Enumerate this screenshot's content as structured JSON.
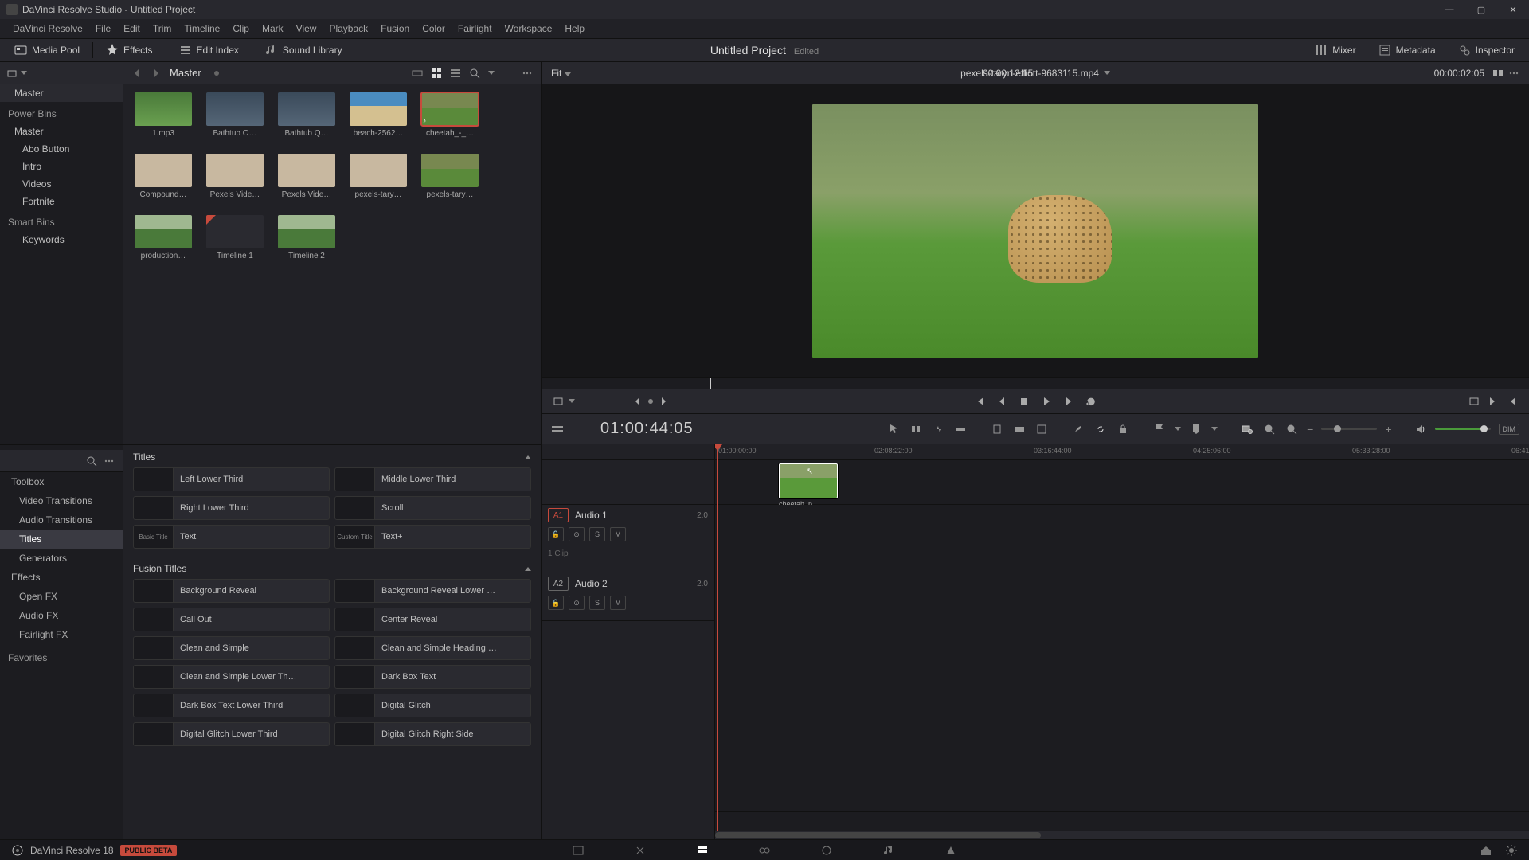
{
  "window": {
    "title": "DaVinci Resolve Studio - Untitled Project"
  },
  "menu": [
    "DaVinci Resolve",
    "File",
    "Edit",
    "Trim",
    "Timeline",
    "Clip",
    "Mark",
    "View",
    "Playback",
    "Fusion",
    "Color",
    "Fairlight",
    "Workspace",
    "Help"
  ],
  "toolbar": {
    "mediapool": "Media Pool",
    "effects": "Effects",
    "editindex": "Edit Index",
    "soundlib": "Sound Library",
    "project": "Untitled Project",
    "edited": "Edited",
    "mixer": "Mixer",
    "metadata": "Metadata",
    "inspector": "Inspector"
  },
  "bins": {
    "root": "Master",
    "power_title": "Power Bins",
    "power_root": "Master",
    "power_items": [
      "Abo Button",
      "Intro",
      "Videos",
      "Fortnite"
    ],
    "smart_title": "Smart Bins",
    "smart_items": [
      "Keywords"
    ]
  },
  "clipshead": {
    "title": "Master"
  },
  "clips": [
    {
      "label": "1.mp3",
      "cls": "audio"
    },
    {
      "label": "Bathtub O…",
      "cls": "video"
    },
    {
      "label": "Bathtub Q…",
      "cls": "video"
    },
    {
      "label": "beach-2562…",
      "cls": "beach"
    },
    {
      "label": "cheetah_-_…",
      "cls": "cheetah",
      "selected": true,
      "badge": "♪"
    },
    {
      "label": "Compound…",
      "cls": "indoor"
    },
    {
      "label": "Pexels Vide…",
      "cls": "indoor"
    },
    {
      "label": "Pexels Vide…",
      "cls": "indoor"
    },
    {
      "label": "pexels-tary…",
      "cls": "indoor"
    },
    {
      "label": "pexels-tary…",
      "cls": "cheetah"
    },
    {
      "label": "production…",
      "cls": "grass"
    },
    {
      "label": "Timeline 1",
      "cls": "tl"
    },
    {
      "label": "Timeline 2",
      "cls": "grass"
    }
  ],
  "fx": {
    "cats_root": "Toolbox",
    "cats": [
      "Video Transitions",
      "Audio Transitions",
      "Titles",
      "Generators"
    ],
    "cats2_root": "Effects",
    "cats2": [
      "Open FX",
      "Audio FX",
      "Fairlight FX"
    ],
    "fav": "Favorites",
    "titles_header": "Titles",
    "titles": [
      "Left Lower Third",
      "Middle Lower Third",
      "Right Lower Third",
      "Scroll",
      "Text",
      "Text+"
    ],
    "titles_thumbs": [
      "",
      "",
      "",
      "",
      "Basic Title",
      "Custom Title"
    ],
    "fusion_header": "Fusion Titles",
    "fusion": [
      "Background Reveal",
      "Background Reveal Lower …",
      "Call Out",
      "Center Reveal",
      "Clean and Simple",
      "Clean and Simple Heading …",
      "Clean and Simple Lower Th…",
      "Dark Box Text",
      "Dark Box Text Lower Third",
      "Digital Glitch",
      "Digital Glitch Lower Third",
      "Digital Glitch Right Side"
    ]
  },
  "viewer": {
    "fit": "Fit",
    "src_tc": "00:00:12:15",
    "clipname": "pexels-taryn-elliott-9683115.mp4",
    "rec_tc": "00:00:02:05"
  },
  "timeline": {
    "tc": "01:00:44:05",
    "ruler": [
      "01:00:00:00",
      "02:08:22:00",
      "03:16:44:00",
      "04:25:06:00",
      "05:33:28:00",
      "06:41"
    ],
    "a1_tag": "A1",
    "a1_name": "Audio 1",
    "a1_ch": "2.0",
    "a1_clips": "1 Clip",
    "a2_tag": "A2",
    "a2_name": "Audio 2",
    "a2_ch": "2.0",
    "clip_label": "cheetah_p…",
    "dim": "DIM"
  },
  "footer": {
    "brand": "DaVinci Resolve 18",
    "beta": "PUBLIC BETA"
  }
}
